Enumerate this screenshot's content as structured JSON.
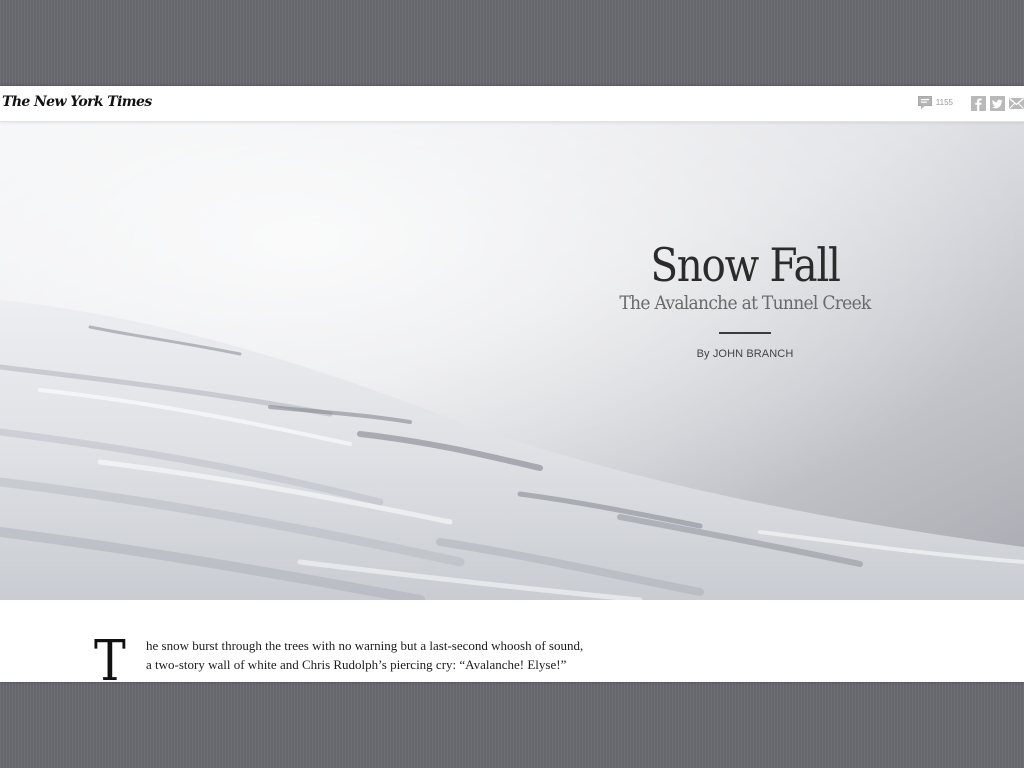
{
  "header": {
    "logo_text": "The New York Times",
    "comment_count": "1155",
    "icons": [
      "comment-icon",
      "facebook-icon",
      "twitter-icon",
      "email-icon"
    ]
  },
  "hero": {
    "title": "Snow Fall",
    "subtitle": "The Avalanche at Tunnel Creek",
    "byline": "By JOHN BRANCH"
  },
  "story": {
    "dropcap": "T",
    "line1": "he snow burst through the trees with no warning but a last-second whoosh of sound,",
    "line2": "a two-story wall of white and Chris Rudolph’s piercing cry: “Avalanche! Elyse!”"
  },
  "colors": {
    "backdrop": "#6a6b70",
    "page": "#ffffff",
    "title_text": "#2b2b2b",
    "subtitle_text": "#6a6a6a"
  }
}
